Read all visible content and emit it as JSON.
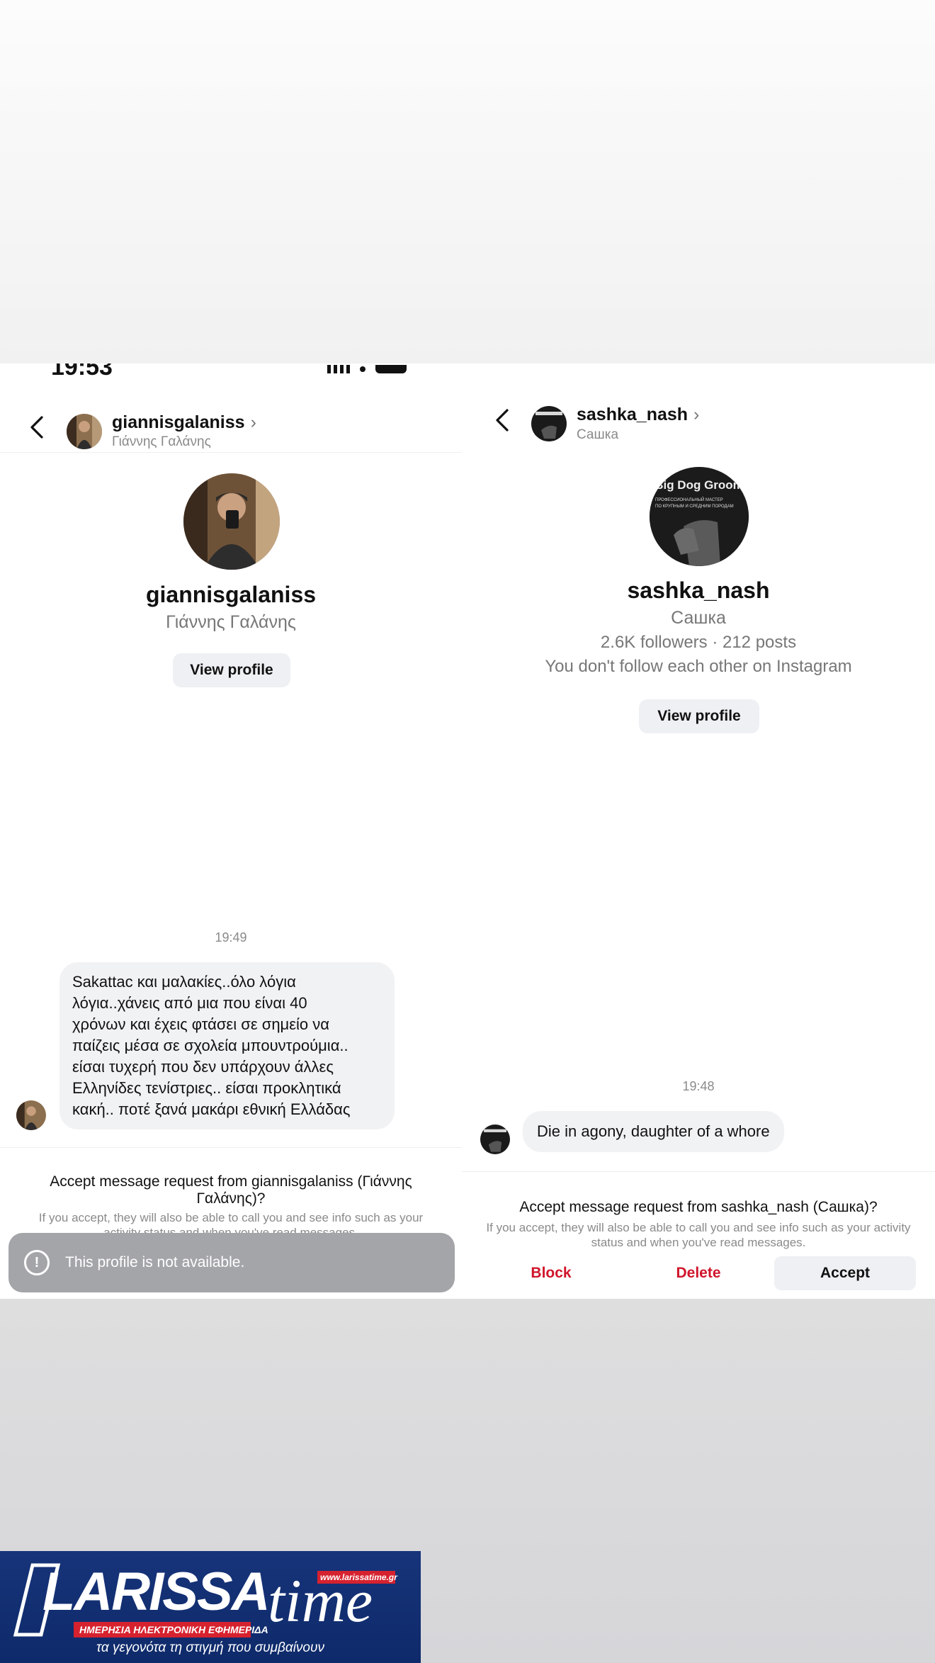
{
  "left": {
    "status_time": "19:53",
    "header_username": "giannisgalaniss",
    "header_fullname": "Γιάννης Γαλάνης",
    "profile_username": "giannisgalaniss",
    "profile_fullname": "Γιάννης Γαλάνης",
    "view_profile": "View profile",
    "message_time": "19:49",
    "message_text": "Sakattac και μαλακίες..όλο λόγια\nλόγια..χάνεις από μια που είναι 40\nχρόνων και έχεις φτάσει σε σημείο να\nπαίζεις μέσα σε σχολεία μπουντρούμια..\nείσαι τυχερή που δεν υπάρχουν άλλες\nΕλληνίδες τενίστριες.. είσαι προκλητικά\nκακή.. ποτέ ξανά μακάρι εθνική Ελλάδας",
    "request_title": "Accept message request from giannisgalaniss (Γιάννης Γαλάνης)?",
    "request_sub": "If you accept, they will also be able to call you and see info such as your activity status and when you've read messages.",
    "toast_icon": "!",
    "toast_text": "This profile is not available."
  },
  "right": {
    "header_username": "sashka_nash",
    "header_fullname": "Сашка",
    "avatar_text": {
      "l1": "Big Dog Groom",
      "l2": "ПРОФЕССИОНАЛЬНЫЙ МАСТЕР",
      "l3": "ПО КРУПНЫМ И СРЕДНИМ ПОРОДАМ"
    },
    "profile_username": "sashka_nash",
    "profile_fullname": "Сашка",
    "stats": "2.6K followers · 212 posts",
    "follow_note": "You don't follow each other on Instagram",
    "view_profile": "View profile",
    "message_time": "19:48",
    "message_text": "Die in agony, daughter of a whore",
    "request_title": "Accept message request from sashka_nash (Сашка)?",
    "request_sub": "If you accept, they will also be able to call you and see info such as your activity status and when you've read messages.",
    "block": "Block",
    "delete": "Delete",
    "accept": "Accept"
  },
  "logo": {
    "brand_a": "LARISSA",
    "brand_b": "time",
    "url": "www.larissatime.gr",
    "tag": "ΗΜΕΡΗΣΙΑ ΗΛΕΚΤΡΟΝΙΚΗ ΕΦΗΜΕΡΙΔΑ",
    "slogan": "τα γεγονότα τη στιγμή που συμβαίνουν"
  },
  "colors": {
    "destructive": "#d0152b",
    "button_bg": "#eef0f3",
    "logo_blue": "#17347a",
    "logo_red": "#d6222f"
  }
}
